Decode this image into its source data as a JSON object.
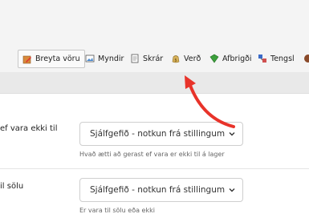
{
  "toolbar": {
    "tabs": [
      {
        "label": "Breyta vöru",
        "icon": "edit-product-icon",
        "active": true
      },
      {
        "label": "Myndir",
        "icon": "images-icon"
      },
      {
        "label": "Skrár",
        "icon": "files-icon"
      },
      {
        "label": "Verð",
        "icon": "price-icon"
      },
      {
        "label": "Afbrigði",
        "icon": "variants-icon"
      },
      {
        "label": "Tengsl",
        "icon": "relations-icon"
      }
    ]
  },
  "form": {
    "row1": {
      "label": "ef vara ekki til",
      "select_value": "Sjálfgefið - notkun frá stillingum",
      "help": "Hvað ætti að gerast ef vara er ekki til á lager"
    },
    "row2": {
      "label": "il sölu",
      "select_value": "Sjálfgefið - notkun frá stillingum",
      "help": "Er vara til sölu eða ekki"
    }
  },
  "colors": {
    "arrow": "#e8332a",
    "accent": "#e8332a"
  }
}
